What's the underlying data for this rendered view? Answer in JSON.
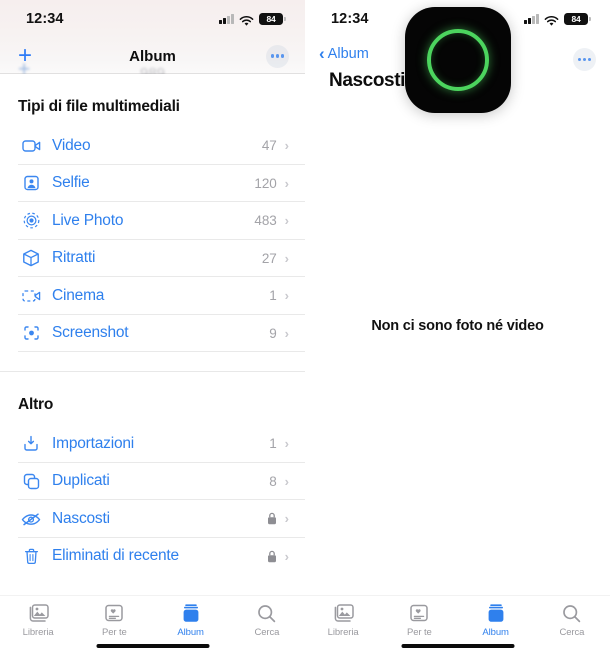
{
  "left": {
    "status_bar": {
      "time": "12:34",
      "battery": "84",
      "signal_icon": "cellular-signal-icon",
      "wifi_icon": "wifi-icon",
      "battery_icon": "battery-icon"
    },
    "nav": {
      "add_label": "+",
      "title": "Album",
      "more_icon": "ellipsis-icon"
    },
    "ghost_scroll": {
      "plus": "+",
      "number": "989"
    },
    "sections": [
      {
        "title": "Tipi di file multimediali",
        "rows": [
          {
            "icon": "video-camera-icon",
            "label": "Video",
            "count": "47",
            "chevron": "›"
          },
          {
            "icon": "selfie-person-icon",
            "label": "Selfie",
            "count": "120",
            "chevron": "›"
          },
          {
            "icon": "live-photo-icon",
            "label": "Live Photo",
            "count": "483",
            "chevron": "›"
          },
          {
            "icon": "portrait-cube-icon",
            "label": "Ritratti",
            "count": "27",
            "chevron": "›"
          },
          {
            "icon": "cinematic-icon",
            "label": "Cinema",
            "count": "1",
            "chevron": "›"
          },
          {
            "icon": "screenshot-icon",
            "label": "Screenshot",
            "count": "9",
            "chevron": "›"
          }
        ]
      },
      {
        "title": "Altro",
        "rows": [
          {
            "icon": "import-icon",
            "label": "Importazioni",
            "count": "1",
            "chevron": "›"
          },
          {
            "icon": "duplicates-icon",
            "label": "Duplicati",
            "count": "8",
            "chevron": "›"
          },
          {
            "icon": "hidden-eye-icon",
            "label": "Nascosti",
            "count": "",
            "locked": true,
            "chevron": "›"
          },
          {
            "icon": "trash-icon",
            "label": "Eliminati di recente",
            "count": "",
            "locked": true,
            "chevron": "›"
          }
        ]
      }
    ],
    "tabs": [
      {
        "icon": "library-icon",
        "label": "Libreria",
        "active": false
      },
      {
        "icon": "for-you-icon",
        "label": "Per te",
        "active": false
      },
      {
        "icon": "albums-icon",
        "label": "Album",
        "active": true
      },
      {
        "icon": "search-icon",
        "label": "Cerca",
        "active": false
      }
    ]
  },
  "right": {
    "status_bar": {
      "time": "12:34",
      "battery": "84",
      "signal_icon": "cellular-signal-icon",
      "wifi_icon": "wifi-icon",
      "battery_icon": "battery-icon"
    },
    "nav": {
      "back_label": "Album",
      "back_icon": "chevron-left-icon",
      "title": "Nascosti",
      "more_icon": "ellipsis-icon"
    },
    "dynamic_island": {
      "icon": "camera-recording-ring-icon",
      "ring_color": "#4CD45E",
      "background_color": "#050505"
    },
    "empty_state": {
      "message": "Non ci sono foto né video"
    },
    "tabs": [
      {
        "icon": "library-icon",
        "label": "Libreria",
        "active": false
      },
      {
        "icon": "for-you-icon",
        "label": "Per te",
        "active": false
      },
      {
        "icon": "albums-icon",
        "label": "Album",
        "active": true
      },
      {
        "icon": "search-icon",
        "label": "Cerca",
        "active": false
      }
    ]
  },
  "colors": {
    "accent": "#2F80ED",
    "icon_blue": "#3B87F0",
    "muted": "#9A9A9F",
    "count": "#A3A3A8",
    "green": "#4CD45E"
  }
}
